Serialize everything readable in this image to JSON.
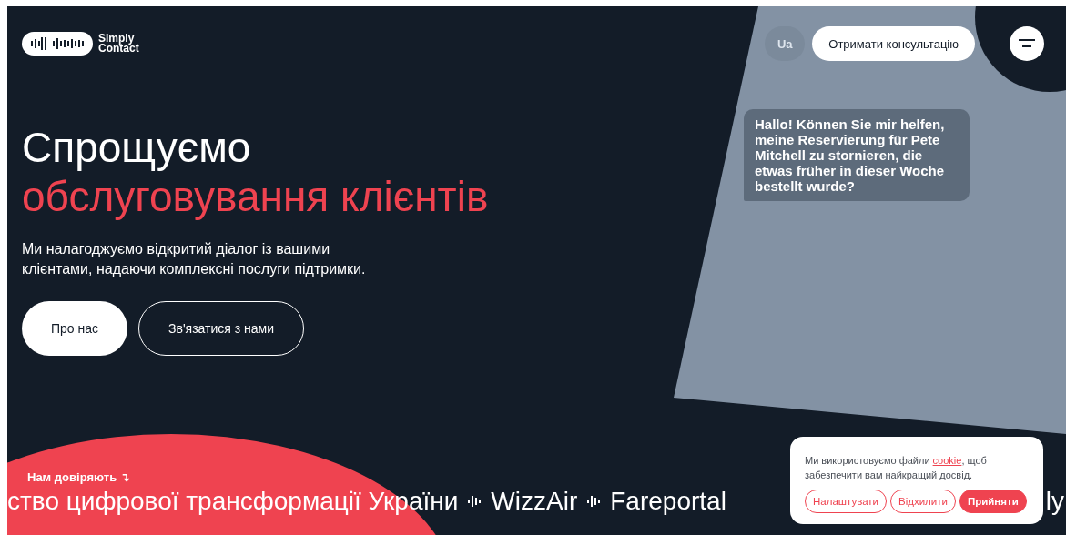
{
  "header": {
    "logo_text": "Simply\nContact",
    "language": "Ua",
    "consult_button": "Отримати консультацію"
  },
  "hero": {
    "title": "Спрощуємо",
    "title_accent": "обслуговування клієнтів",
    "description": "Ми налагоджуємо відкритий діалог із вашими клієнтами, надаючи комплексні послуги підтримки.",
    "buttons": [
      {
        "label": "Про нас",
        "kind": "filled"
      },
      {
        "label": "Зв'язатися з нами",
        "kind": "outline"
      }
    ]
  },
  "chat_bubble": "Hallo! Können Sie mir helfen, meine Reservierung für Pete Mitchell zu stornieren, die etwas früher in dieser Woche bestellt wurde?",
  "trusted": {
    "label": "Нам довіряють ↴",
    "clients": [
      "ство цифрової трансформації України",
      "WizzAir",
      "Fareportal",
      "ly"
    ]
  },
  "cookie_banner": {
    "text_before": "Ми використовуємо файли ",
    "link": "cookie",
    "text_after": ", щоб забезпечити вам найкращий досвід.",
    "buttons": [
      {
        "label": "Налаштувати",
        "kind": "outline"
      },
      {
        "label": "Відхилити",
        "kind": "outline"
      },
      {
        "label": "Прийняти",
        "kind": "filled"
      }
    ]
  }
}
